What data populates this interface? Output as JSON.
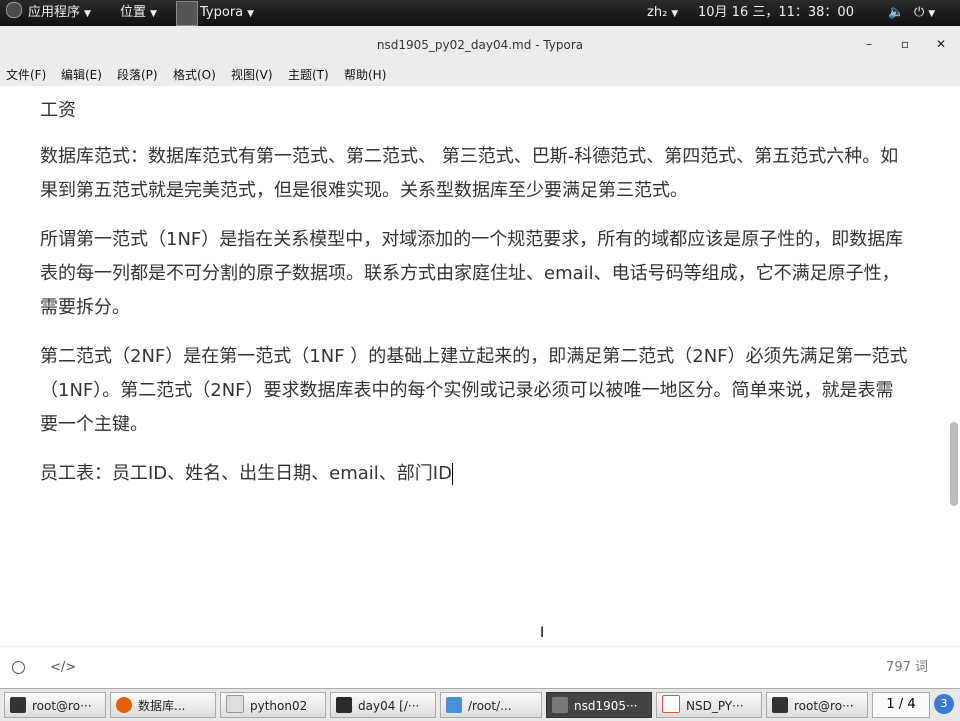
{
  "topbar": {
    "apps_label": "应用程序",
    "places_label": "位置",
    "active_app_label": "Typora",
    "input_method": "zh₂",
    "datetime": "10月 16 三，11：38：00"
  },
  "window": {
    "title": "nsd1905_py02_day04.md - Typora",
    "minimize_glyph": "–",
    "maximize_glyph": "▫",
    "close_glyph": "✕"
  },
  "menu": {
    "items": [
      {
        "label": "文件(F)"
      },
      {
        "label": "编辑(E)"
      },
      {
        "label": "段落(P)"
      },
      {
        "label": "格式(O)"
      },
      {
        "label": "视图(V)"
      },
      {
        "label": "主题(T)"
      },
      {
        "label": "帮助(H)"
      }
    ]
  },
  "document": {
    "paragraphs": [
      "工资",
      "数据库范式：数据库范式有第一范式、第二范式、 第三范式、巴斯-科德范式、第四范式、第五范式六种。如果到第五范式就是完美范式，但是很难实现。关系型数据库至少要满足第三范式。",
      "所谓第一范式（1NF）是指在关系模型中，对域添加的一个规范要求，所有的域都应该是原子性的，即数据库表的每一列都是不可分割的原子数据项。联系方式由家庭住址、email、电话号码等组成，它不满足原子性，需要拆分。",
      "第二范式（2NF）是在第一范式（1NF ）的基础上建立起来的，即满足第二范式（2NF）必须先满足第一范式（1NF）。第二范式（2NF）要求数据库表中的每个实例或记录必须可以被唯一地区分。简单来说，就是表需要一个主键。",
      "员工表：员工ID、姓名、出生日期、email、部门ID"
    ]
  },
  "statusbar": {
    "outline_icon": "circle-icon",
    "source_icon": "code-icon",
    "source_glyph": "</>",
    "word_count": "797 词"
  },
  "taskbar": {
    "tasks": [
      {
        "label": "root@ro···",
        "icon_color": "#333333"
      },
      {
        "label": "数据库...",
        "icon_color": "#e66000"
      },
      {
        "label": "python02",
        "icon_color": "#dddddd"
      },
      {
        "label": "day04 [/···",
        "icon_color": "#2a2a2a"
      },
      {
        "label": "/root/...",
        "icon_color": "#4a90d9"
      },
      {
        "label": "nsd1905···",
        "icon_color": "#555555"
      },
      {
        "label": "NSD_PY···",
        "icon_color": "#d9534f"
      },
      {
        "label": "root@ro···",
        "icon_color": "#333333"
      }
    ],
    "pager": "1 / 4",
    "notification_count": "3"
  }
}
